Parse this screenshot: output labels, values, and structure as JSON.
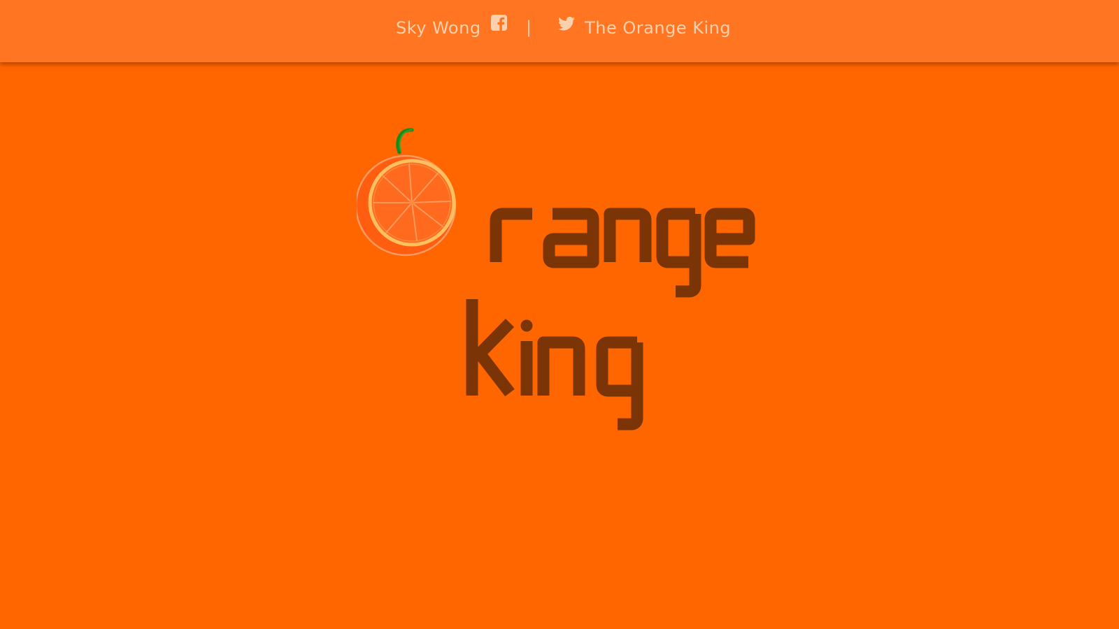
{
  "header": {
    "facebook_label": "Sky Wong",
    "facebook_icon": "facebook-square-icon",
    "divider": "|",
    "twitter_icon": "twitter-icon",
    "twitter_label": "The Orange King"
  },
  "logo": {
    "icon": "orange-slice-icon",
    "word1": "range",
    "word2": "king"
  },
  "colors": {
    "background": "#ff6600",
    "header_background": "#ff7521",
    "header_text": "#fbd0ac",
    "wordmark": "#7a3405",
    "stem": "#1a8a1a"
  }
}
